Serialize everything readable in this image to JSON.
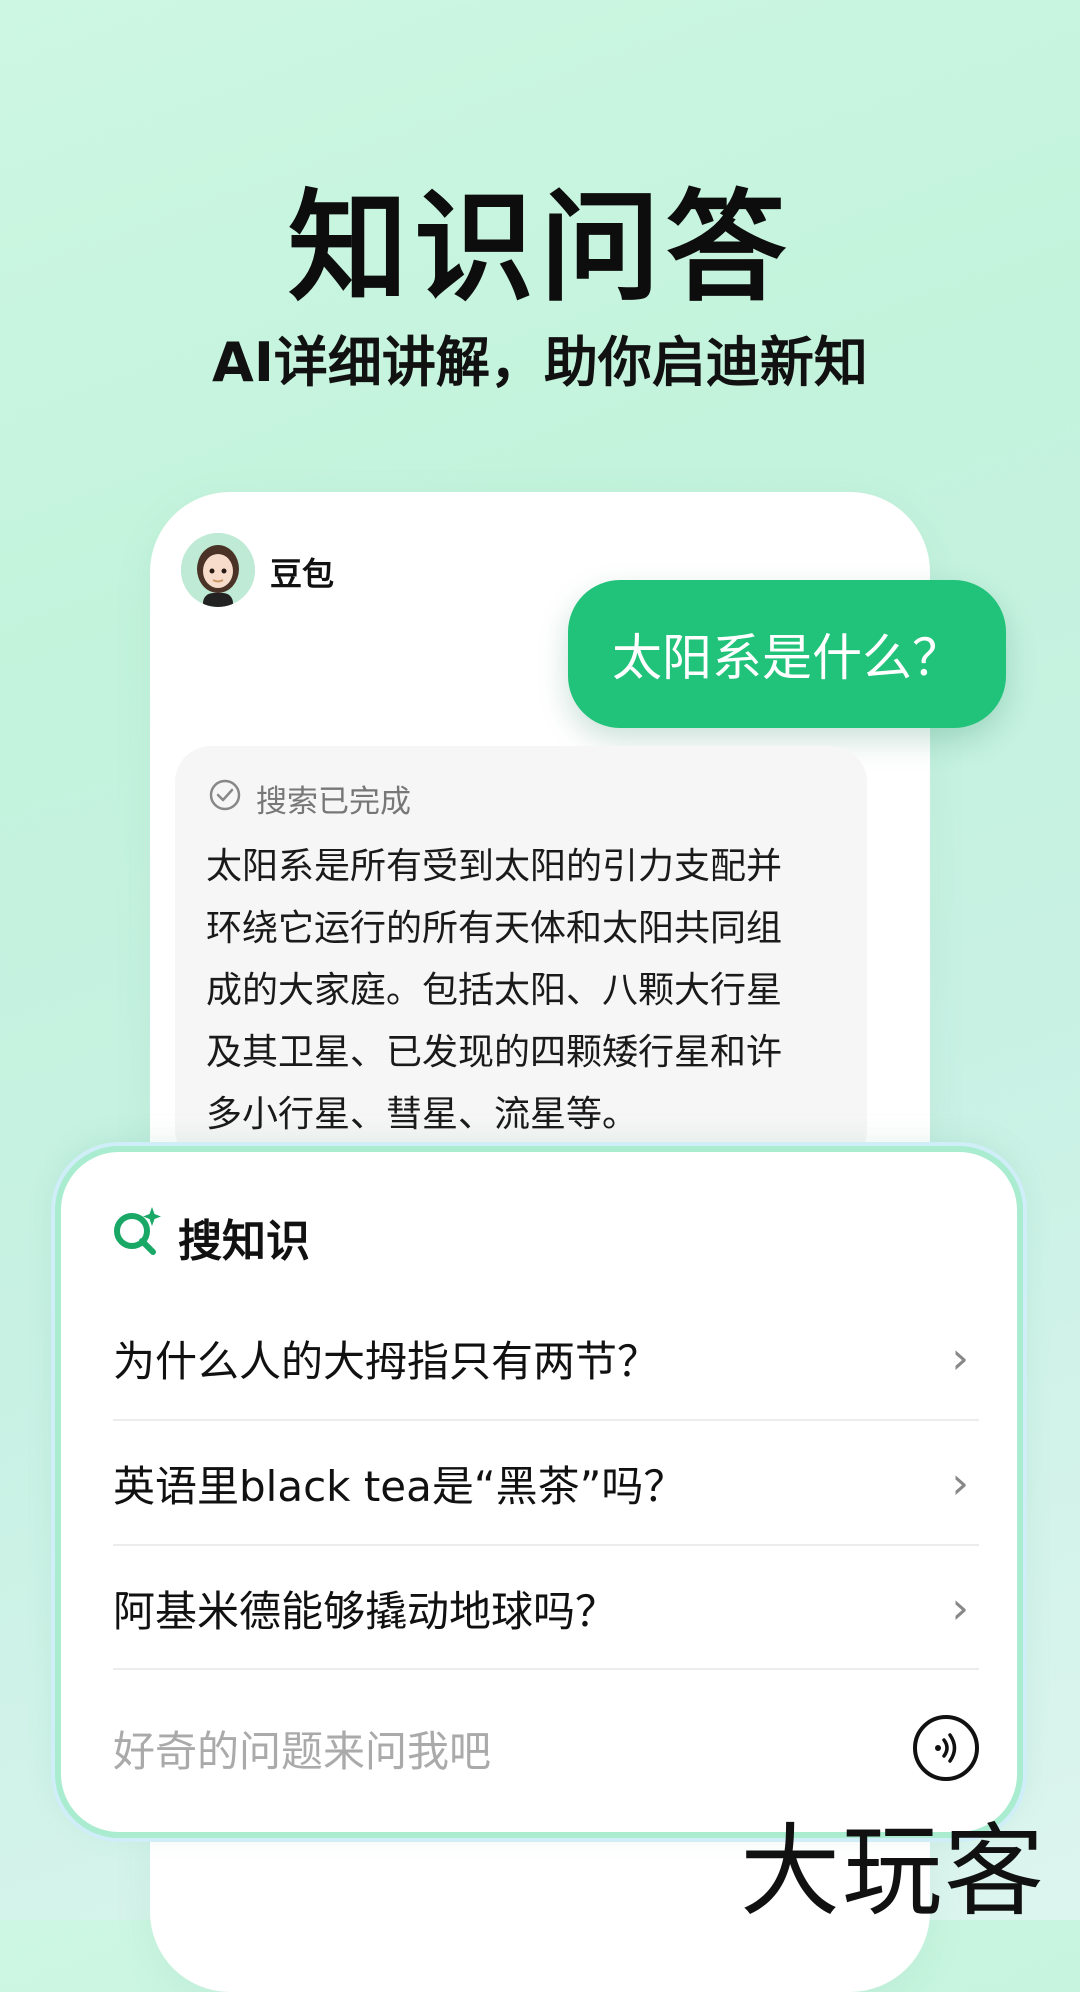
{
  "promo": {
    "headline": "知识问答",
    "subheadline": "AI详细讲解，助你启迪新知"
  },
  "chat": {
    "bot_name": "豆包",
    "user_message": "太阳系是什么？",
    "search_status": "搜索已完成",
    "answer_lines": [
      "太阳系是所有受到太阳的引力支配并",
      "环绕它运行的所有天体和太阳共同组",
      "成的大家庭。包括太阳、八颗大行星",
      "及其卫星、已发现的四颗矮行星和许",
      "多小行星、彗星、流星等。"
    ]
  },
  "search_panel": {
    "title": "搜知识",
    "questions": [
      "为什么人的大拇指只有两节？",
      "英语里black tea是“黑茶”吗？",
      "阿基米德能够撬动地球吗？"
    ],
    "input_placeholder": "好奇的问题来问我吧"
  },
  "watermark": "大玩客",
  "colors": {
    "accent_green": "#21c27a",
    "brand_icon_green": "#1aa867"
  },
  "icons": {
    "status": "check-circle-icon",
    "panel": "search-sparkle-icon",
    "row": "chevron-right-icon",
    "voice": "voice-wave-icon"
  }
}
